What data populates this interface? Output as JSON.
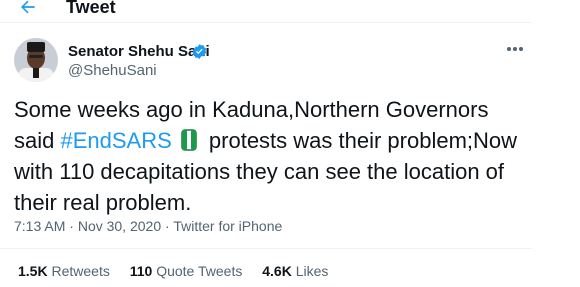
{
  "header": {
    "title": "Tweet",
    "back_icon": "arrow-left-icon"
  },
  "author": {
    "name": "Senator Shehu Sani",
    "handle": "@ShehuSani",
    "verified_icon": "verified-badge-icon",
    "avatar_icon": "avatar"
  },
  "tweet": {
    "text_before": "Some weeks ago in Kaduna,Northern Governors said",
    "hashtag": "#EndSARS",
    "flag_icon": "nigeria-flag-emoji-icon",
    "text_after": "protests was their problem;Now with 110 decapitations they can see the location of their real problem."
  },
  "meta": {
    "time": "7:13 AM",
    "separator": " · ",
    "date": "Nov 30, 2020",
    "source": "Twitter for iPhone"
  },
  "stats": {
    "retweets_count": "1.5K",
    "retweets_label": "Retweets",
    "quote_count": "110",
    "quote_label": "Quote Tweets",
    "likes_count": "4.6K",
    "likes_label": "Likes"
  },
  "colors": {
    "accent": "#1d9bf0",
    "text": "#0f1419",
    "muted": "#536471",
    "divider": "#eff3f4"
  }
}
